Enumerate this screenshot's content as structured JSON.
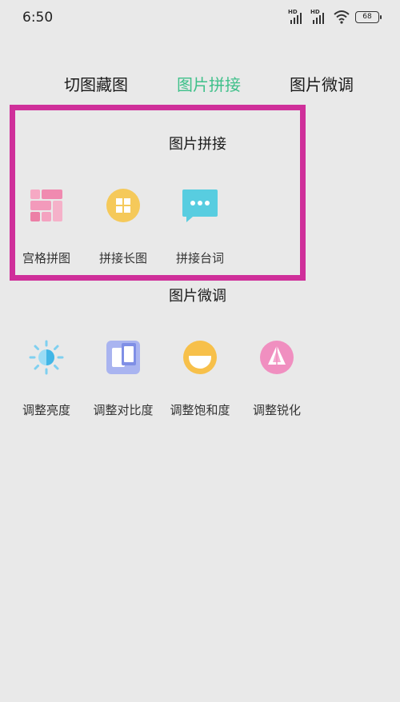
{
  "status_bar": {
    "time": "6:50",
    "battery": "68",
    "signal_label": "HD"
  },
  "tabs": [
    {
      "label": "切图藏图",
      "active": false
    },
    {
      "label": "图片拼接",
      "active": true
    },
    {
      "label": "图片微调",
      "active": false
    }
  ],
  "sections": [
    {
      "title": "图片拼接",
      "tools": [
        {
          "label": "宫格拼图",
          "icon": "grid-collage-icon"
        },
        {
          "label": "拼接长图",
          "icon": "long-image-icon"
        },
        {
          "label": "拼接台词",
          "icon": "chat-bubble-icon"
        }
      ]
    },
    {
      "title": "图片微调",
      "tools": [
        {
          "label": "调整亮度",
          "icon": "brightness-icon"
        },
        {
          "label": "调整对比度",
          "icon": "contrast-icon"
        },
        {
          "label": "调整饱和度",
          "icon": "saturation-icon"
        },
        {
          "label": "调整锐化",
          "icon": "sharpen-icon"
        }
      ]
    }
  ],
  "colors": {
    "accent": "#3fc08a",
    "highlight_border": "#cf2f9a",
    "background": "#e9e9e9"
  }
}
